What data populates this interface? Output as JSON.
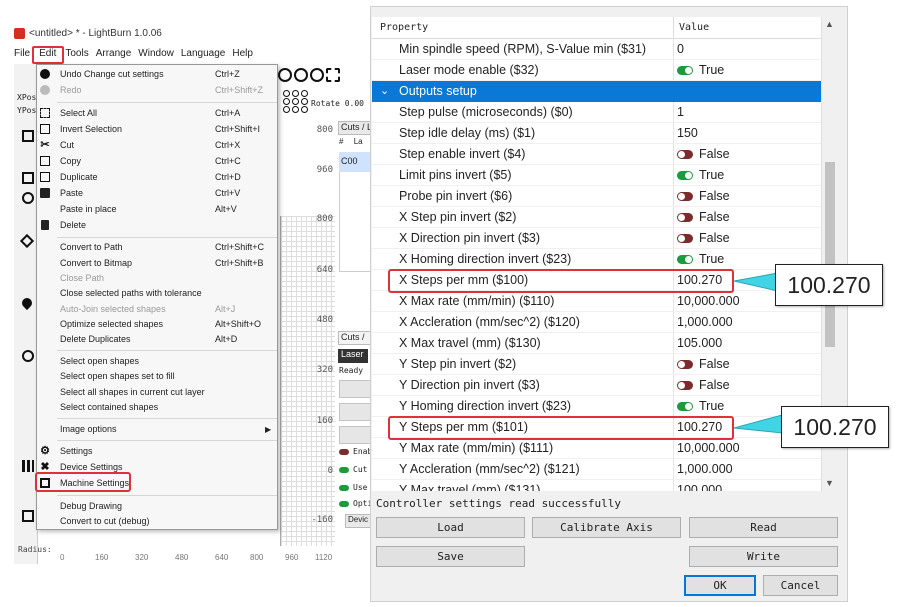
{
  "window": {
    "title": "<untitled> * - LightBurn 1.0.06"
  },
  "menubar": [
    "File",
    "Edit",
    "Tools",
    "Arrange",
    "Window",
    "Language",
    "Help"
  ],
  "toolbar": {
    "rotate_label": "Rotate 0.00",
    "coord_x_label": "XPos",
    "coord_y_label": "YPos",
    "radius_label": "Radius:"
  },
  "ruler": {
    "vertical": [
      "800",
      "960",
      "800",
      "640",
      "480",
      "320",
      "160",
      "0",
      "-160"
    ],
    "bottom": [
      "0",
      "160",
      "320",
      "480",
      "640",
      "800",
      "960",
      "1120"
    ]
  },
  "cuts_panel": {
    "tab": "Cuts / L",
    "columns": [
      "#",
      "La"
    ],
    "row": "C00",
    "bottom_tab": "Cuts /",
    "laser_tab": "Laser",
    "status": "Ready",
    "toggles": [
      {
        "label": "Enab",
        "state": "off"
      },
      {
        "label": "Cut",
        "state": "on"
      },
      {
        "label": "Use",
        "state": "on"
      },
      {
        "label": "Opti",
        "state": "on"
      }
    ],
    "devices_button": "Devic"
  },
  "edit_menu": {
    "items": [
      {
        "label": "Undo Change cut settings",
        "shortcut": "Ctrl+Z",
        "icon": "undo-icon",
        "disabled": false
      },
      {
        "label": "Redo",
        "shortcut": "Ctrl+Shift+Z",
        "icon": "redo-icon",
        "disabled": true
      },
      {
        "label": "Select All",
        "shortcut": "Ctrl+A",
        "icon": "select-all-icon",
        "disabled": false
      },
      {
        "label": "Invert Selection",
        "shortcut": "Ctrl+Shift+I",
        "icon": "invert-selection-icon",
        "disabled": false
      },
      {
        "label": "Cut",
        "shortcut": "Ctrl+X",
        "icon": "scissors-icon",
        "disabled": false
      },
      {
        "label": "Copy",
        "shortcut": "Ctrl+C",
        "icon": "copy-icon",
        "disabled": false
      },
      {
        "label": "Duplicate",
        "shortcut": "Ctrl+D",
        "icon": "duplicate-icon",
        "disabled": false
      },
      {
        "label": "Paste",
        "shortcut": "Ctrl+V",
        "icon": "paste-icon",
        "disabled": false
      },
      {
        "label": "Paste in place",
        "shortcut": "Alt+V",
        "icon": "",
        "disabled": false
      },
      {
        "label": "Delete",
        "shortcut": "",
        "icon": "trash-icon",
        "disabled": false
      },
      {
        "label": "Convert to Path",
        "shortcut": "Ctrl+Shift+C",
        "icon": "",
        "disabled": false
      },
      {
        "label": "Convert to Bitmap",
        "shortcut": "Ctrl+Shift+B",
        "icon": "",
        "disabled": false
      },
      {
        "label": "Close Path",
        "shortcut": "",
        "icon": "",
        "disabled": true
      },
      {
        "label": "Close selected paths with tolerance",
        "shortcut": "",
        "icon": "",
        "disabled": false
      },
      {
        "label": "Auto-Join selected shapes",
        "shortcut": "Alt+J",
        "icon": "",
        "disabled": true
      },
      {
        "label": "Optimize selected shapes",
        "shortcut": "Alt+Shift+O",
        "icon": "",
        "disabled": false
      },
      {
        "label": "Delete Duplicates",
        "shortcut": "Alt+D",
        "icon": "",
        "disabled": false
      },
      {
        "label": "Select open shapes",
        "shortcut": "",
        "icon": "",
        "disabled": false
      },
      {
        "label": "Select open shapes set to fill",
        "shortcut": "",
        "icon": "",
        "disabled": false
      },
      {
        "label": "Select all shapes in current cut layer",
        "shortcut": "",
        "icon": "",
        "disabled": false
      },
      {
        "label": "Select contained shapes",
        "shortcut": "",
        "icon": "",
        "disabled": false
      },
      {
        "label": "Image options",
        "shortcut": "",
        "icon": "",
        "disabled": false,
        "submenu": true
      },
      {
        "label": "Settings",
        "shortcut": "",
        "icon": "gear-icon",
        "disabled": false
      },
      {
        "label": "Device Settings",
        "shortcut": "",
        "icon": "wrench-icon",
        "disabled": false
      },
      {
        "label": "Machine Settings",
        "shortcut": "",
        "icon": "machine-icon",
        "disabled": false
      },
      {
        "label": "Debug Drawing",
        "shortcut": "",
        "icon": "",
        "disabled": false
      },
      {
        "label": "Convert to cut (debug)",
        "shortcut": "",
        "icon": "",
        "disabled": false
      }
    ]
  },
  "settings_dialog": {
    "columns": {
      "property": "Property",
      "value": "Value"
    },
    "rows": [
      {
        "name": "Min spindle speed (RPM), S-Value min ($31)",
        "value": "0"
      },
      {
        "name": "Laser mode enable ($32)",
        "value": "True",
        "toggle": "on"
      },
      {
        "name": "Outputs setup",
        "group": true
      },
      {
        "name": "Step pulse (microseconds) ($0)",
        "value": "1"
      },
      {
        "name": "Step idle delay (ms) ($1)",
        "value": "150"
      },
      {
        "name": "Step enable invert ($4)",
        "value": "False",
        "toggle": "off"
      },
      {
        "name": "Limit pins invert ($5)",
        "value": "True",
        "toggle": "on"
      },
      {
        "name": "Probe pin invert ($6)",
        "value": "False",
        "toggle": "off"
      },
      {
        "name": "X Step pin invert ($2)",
        "value": "False",
        "toggle": "off"
      },
      {
        "name": "X Direction pin invert ($3)",
        "value": "False",
        "toggle": "off"
      },
      {
        "name": "X Homing direction invert ($23)",
        "value": "True",
        "toggle": "on"
      },
      {
        "name": "X Steps per mm ($100)",
        "value": "100.270",
        "highlight": true
      },
      {
        "name": "X Max rate (mm/min) ($110)",
        "value": "10,000.000"
      },
      {
        "name": "X Accleration (mm/sec^2) ($120)",
        "value": "1,000.000"
      },
      {
        "name": "X Max travel (mm) ($130)",
        "value": "105.000"
      },
      {
        "name": "Y Step pin invert ($2)",
        "value": "False",
        "toggle": "off"
      },
      {
        "name": "Y Direction pin invert ($3)",
        "value": "False",
        "toggle": "off"
      },
      {
        "name": "Y Homing direction invert ($23)",
        "value": "True",
        "toggle": "on"
      },
      {
        "name": "Y Steps per mm ($101)",
        "value": "100.270",
        "highlight": true
      },
      {
        "name": "Y Max rate (mm/min) ($111)",
        "value": "10,000.000"
      },
      {
        "name": "Y Accleration (mm/sec^2) ($121)",
        "value": "1,000.000"
      },
      {
        "name": "Y Max travel (mm) ($131)",
        "value": "100.000"
      }
    ],
    "status": "Controller settings read successfully",
    "buttons": {
      "load": "Load",
      "calibrate": "Calibrate Axis",
      "read": "Read",
      "save": "Save",
      "write": "Write",
      "ok": "OK",
      "cancel": "Cancel"
    }
  },
  "callouts": {
    "x_value": "100.270",
    "y_value": "100.270"
  },
  "colors": {
    "highlight_red": "#e0303a",
    "group_blue": "#0a78d7",
    "toggle_on": "#1a9c3c",
    "toggle_off": "#7a2c2c",
    "callout_arrow": "#40d4e4"
  }
}
